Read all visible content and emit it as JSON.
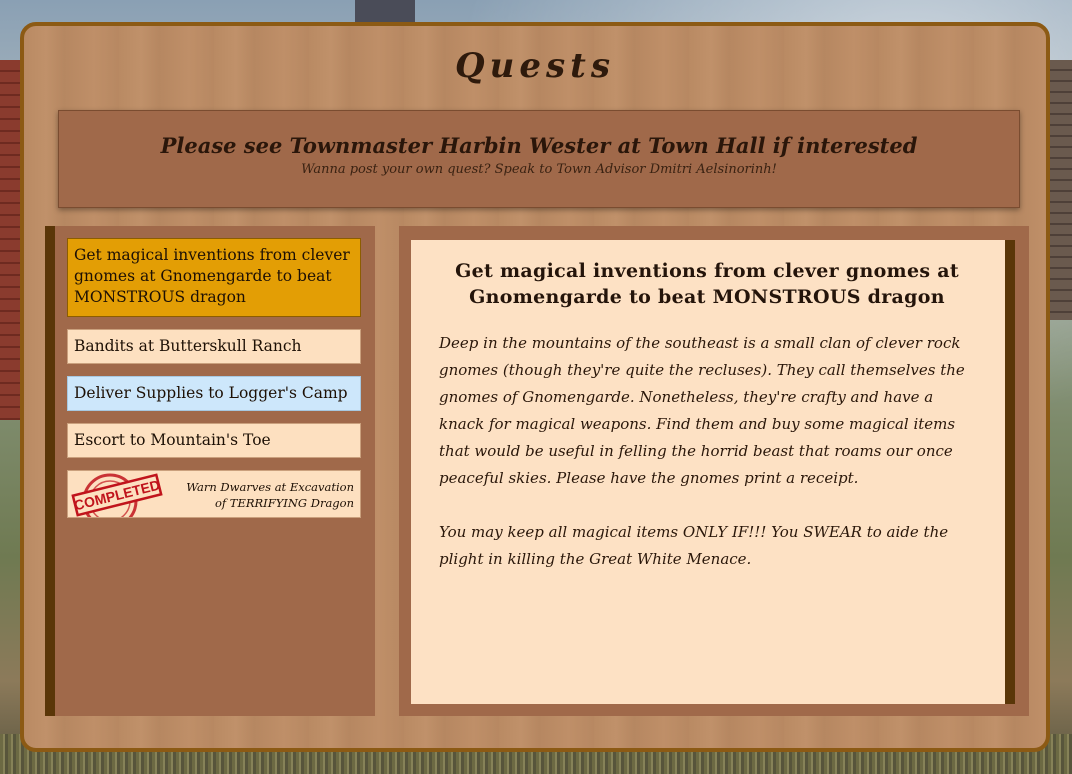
{
  "page": {
    "title": "Quests"
  },
  "notice": {
    "main": "Please see Townmaster Harbin Wester at Town Hall if interested",
    "sub": "Wanna post your own quest? Speak to Town Advisor Dmitri Aelsinorinh!"
  },
  "quests": [
    {
      "label": "Get magical inventions from clever gnomes at Gnomengarde to beat MONSTROUS dragon",
      "state": "active"
    },
    {
      "label": "Bandits at Butterskull Ranch",
      "state": "default"
    },
    {
      "label": "Deliver Supplies to Logger's Camp",
      "state": "highlighted"
    },
    {
      "label": "Escort to Mountain's Toe",
      "state": "default"
    },
    {
      "label": "Warn Dwarves at Excavation of TERRIFYING Dragon",
      "state": "completed",
      "stamp_text": "COMPLETED"
    }
  ],
  "detail": {
    "title": "Get magical inventions from clever gnomes at Gnomengarde to beat MONSTROUS dragon",
    "paragraphs": [
      "Deep in the mountains of the southeast is a small clan of clever rock gnomes (though they're quite the recluses). They call themselves the gnomes of Gnomengarde. Nonetheless, they're crafty and have a knack for magical weapons. Find them and buy some magical items that would be useful in felling the horrid beast that roams our once peaceful skies. Please have the gnomes print a receipt.",
      "You may keep all magical items ONLY IF!!! You SWEAR to aide the plight in killing the Great White Menace."
    ]
  },
  "colors": {
    "active_item": "#e39e05",
    "highlight_item": "#cde7fb",
    "stamp_red": "#c0141c",
    "panel_border": "#8c5a14"
  }
}
